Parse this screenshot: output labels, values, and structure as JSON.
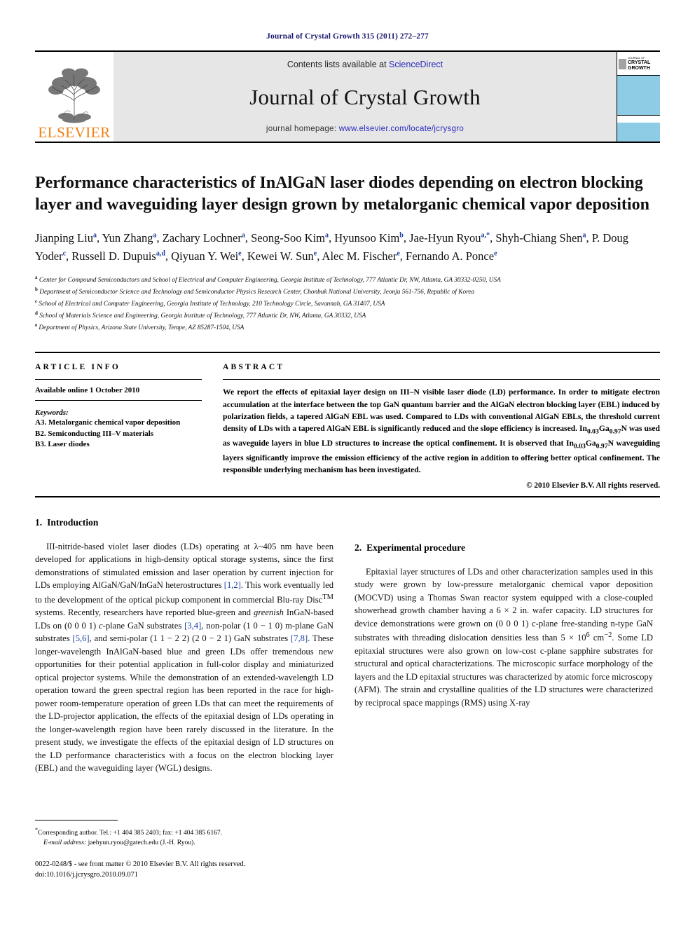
{
  "running_head": "Journal of Crystal Growth 315 (2011) 272–277",
  "masthead": {
    "publisher_name": "ELSEVIER",
    "contents_prefix": "Contents lists available at",
    "contents_link": "ScienceDirect",
    "journal_title": "Journal of Crystal Growth",
    "homepage_prefix": "journal homepage:",
    "homepage_url": "www.elsevier.com/locate/jcrysgro",
    "cover": {
      "line1": "JOURNAL OF",
      "line2": "CRYSTAL",
      "line3": "GROWTH",
      "accent_color": "#8ecbe4"
    },
    "link_color": "#2b2bbf",
    "brand_color": "#F07F13"
  },
  "title": "Performance characteristics of InAlGaN laser diodes depending on electron blocking layer and waveguiding layer design grown by metalorganic chemical vapor deposition",
  "authors": [
    {
      "name": "Jianping Liu",
      "marks": "a",
      "sep": ", "
    },
    {
      "name": "Yun Zhang",
      "marks": "a",
      "sep": ", "
    },
    {
      "name": "Zachary Lochner",
      "marks": "a",
      "sep": ", "
    },
    {
      "name": "Seong-Soo Kim",
      "marks": "a",
      "sep": ", "
    },
    {
      "name": "Hyunsoo Kim",
      "marks": "b",
      "sep": ", "
    },
    {
      "name": "Jae-Hyun Ryou",
      "marks": "a,*",
      "sep": ", "
    },
    {
      "name": "Shyh-Chiang Shen",
      "marks": "a",
      "sep": ", "
    },
    {
      "name": "P. Doug Yoder",
      "marks": "c",
      "sep": ", "
    },
    {
      "name": "Russell D. Dupuis",
      "marks": "a,d",
      "sep": ", "
    },
    {
      "name": "Qiyuan Y. Wei",
      "marks": "e",
      "sep": ", "
    },
    {
      "name": "Kewei W. Sun",
      "marks": "e",
      "sep": ", "
    },
    {
      "name": "Alec M. Fischer",
      "marks": "e",
      "sep": ", "
    },
    {
      "name": "Fernando A. Ponce",
      "marks": "e",
      "sep": ""
    }
  ],
  "affiliations": [
    {
      "mark": "a",
      "text": "Center for Compound Semiconductors and School of Electrical and Computer Engineering, Georgia Institute of Technology, 777 Atlantic Dr, NW, Atlanta, GA 30332-0250, USA"
    },
    {
      "mark": "b",
      "text": "Department of Semiconductor Science and Technology and Semiconductor Physics Research Center, Chonbuk National University, Jeonju 561-756, Republic of Korea"
    },
    {
      "mark": "c",
      "text": "School of Electrical and Computer Engineering, Georgia Institute of Technology, 210 Technology Circle, Savannah, GA 31407, USA"
    },
    {
      "mark": "d",
      "text": "School of Materials Science and Engineering, Georgia Institute of Technology, 777 Atlantic Dr, NW, Atlanta, GA 30332, USA"
    },
    {
      "mark": "e",
      "text": "Department of Physics, Arizona State University, Tempe, AZ 85287-1504, USA"
    }
  ],
  "article_info": {
    "heading": "ARTICLE INFO",
    "available_online": "Available online 1 October 2010",
    "keywords_label": "Keywords:",
    "keywords": [
      "A3. Metalorganic chemical vapor deposition",
      "B2. Semiconducting III–V materials",
      "B3. Laser diodes"
    ]
  },
  "abstract": {
    "heading": "ABSTRACT",
    "paragraph_parts": [
      {
        "t": "We report the effects of epitaxial layer design on III–N visible laser diode (LD) performance. In order to mitigate electron accumulation at the interface between the top GaN quantum barrier and the AlGaN electron blocking layer (EBL) induced by polarization fields, a tapered AlGaN EBL was used. Compared to LDs with conventional AlGaN EBLs, the threshold current density of LDs with a tapered AlGaN EBL is significantly reduced and the slope efficiency is increased. In"
      },
      {
        "sub": "0.03"
      },
      {
        "t": "Ga"
      },
      {
        "sub": "0.97"
      },
      {
        "t": "N was used as waveguide layers in blue LD structures to increase the optical confinement. It is observed that In"
      },
      {
        "sub": "0.03"
      },
      {
        "t": "Ga"
      },
      {
        "sub": "0.97"
      },
      {
        "t": "N waveguiding layers significantly improve the emission efficiency of the active region in addition to offering better optical confinement. The responsible underlying mechanism has been investigated."
      }
    ],
    "copyright": "© 2010 Elsevier B.V. All rights reserved."
  },
  "sections": {
    "introduction": {
      "number": "1.",
      "heading": "Introduction",
      "paragraph_parts": [
        {
          "t": "III-nitride-based violet laser diodes (LDs) operating at λ~405 nm have been developed for applications in high-density optical storage systems, since the first demonstrations of stimulated emission and laser operation by current injection for LDs employing AlGaN/GaN/InGaN heterostructures "
        },
        {
          "cite": "[1,2]"
        },
        {
          "t": ". This work eventually led to the development of the optical pickup component in commercial Blu-ray Disc"
        },
        {
          "sup": "TM"
        },
        {
          "t": " systems. Recently, researchers have reported blue-green and "
        },
        {
          "ital": "greenish"
        },
        {
          "t": " InGaN-based LDs on (0 0 0 1) "
        },
        {
          "ital": "c"
        },
        {
          "t": "-plane GaN substrates "
        },
        {
          "cite": "[3,4]"
        },
        {
          "t": ", non-polar (1 0 − 1 0) m-plane GaN substrates "
        },
        {
          "cite": "[5,6]"
        },
        {
          "t": ", and semi-polar (1 1 − 2 2) (2 0 − 2 1) GaN substrates "
        },
        {
          "cite": "[7,8]"
        },
        {
          "t": ". These longer-wavelength InAlGaN-based blue and green LDs offer tremendous new opportunities for their potential application in full-color display and miniaturized optical projector systems. While the demonstration of an extended-wavelength LD operation toward the green spectral region has been reported in the race for high-power room-temperature operation of green LDs that can meet the requirements of the LD-projector application, the effects of the epitaxial design of LDs operating in the longer-wavelength region have been rarely discussed in the literature. In the present study, we investigate the effects of the epitaxial design of LD structures on the LD performance characteristics with a focus on the electron blocking layer (EBL) and the waveguiding layer (WGL) designs."
        }
      ]
    },
    "experimental": {
      "number": "2.",
      "heading": "Experimental procedure",
      "paragraph_parts": [
        {
          "t": "Epitaxial layer structures of LDs and other characterization samples used in this study were grown by low-pressure metalorganic chemical vapor deposition (MOCVD) using a Thomas Swan reactor system equipped with a close-coupled showerhead growth chamber having a 6 × 2 in. wafer capacity. LD structures for device demonstrations were grown on (0 0 0 1) c-plane free-standing n-type GaN substrates with threading dislocation densities less than 5 × 10"
        },
        {
          "sup": "6"
        },
        {
          "t": " cm"
        },
        {
          "sup": "−2"
        },
        {
          "t": ". Some LD epitaxial structures were also grown on low-cost c-plane sapphire substrates for structural and optical characterizations. The microscopic surface morphology of the layers and the LD epitaxial structures was characterized by atomic force microscopy (AFM). The strain and crystalline qualities of the LD structures were characterized by reciprocal space mappings (RMS) using X-ray"
        }
      ]
    }
  },
  "footnote": {
    "corresponding_marker": "*",
    "corresponding": "Corresponding author. Tel.: +1 404 385 2403; fax: +1 404 385 6167.",
    "email_label": "E-mail address:",
    "email": "jaehyun.ryou@gatech.edu (J.-H. Ryou).",
    "imprint_line1": "0022-0248/$ - see front matter © 2010 Elsevier B.V. All rights reserved.",
    "imprint_line2": "doi:10.1016/j.jcrysgro.2010.09.071"
  }
}
